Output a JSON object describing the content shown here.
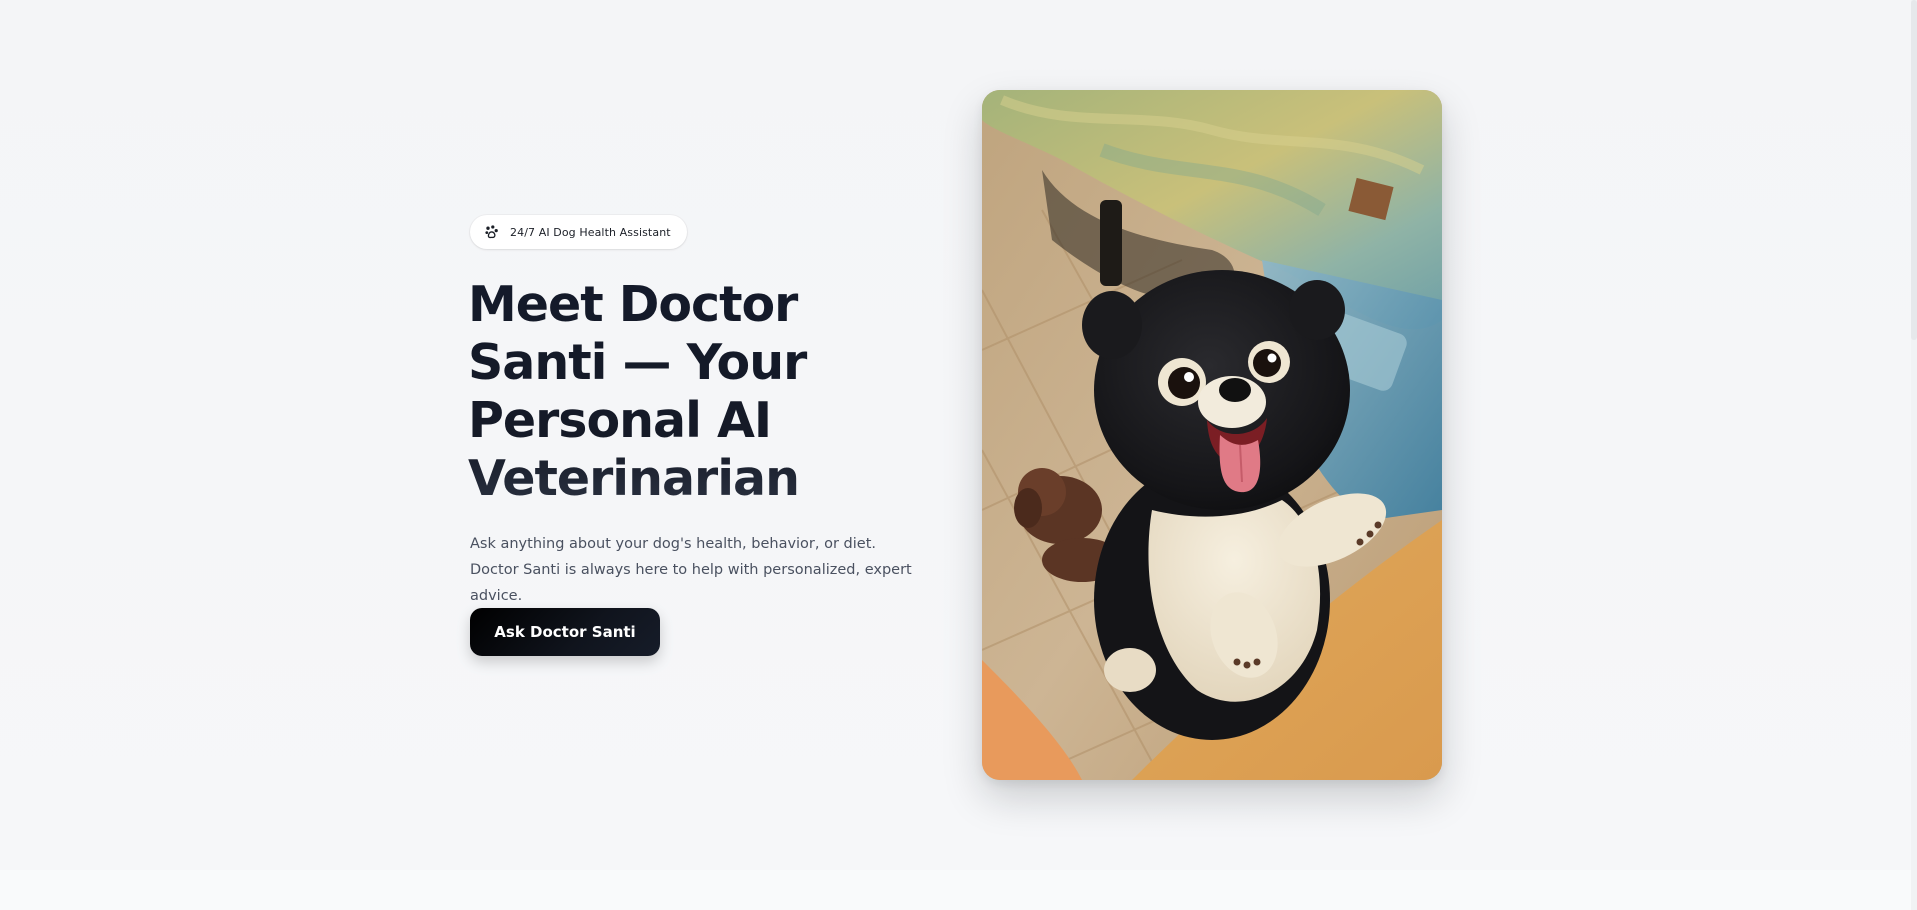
{
  "hero": {
    "badge": {
      "icon": "paw-icon",
      "text": "24/7 AI Dog Health Assistant"
    },
    "headline": "Meet Doctor Santi — Your Personal AI Veterinarian",
    "subtext": "Ask anything about your dog's health, behavior, or diet. Doctor Santi is always here to help with personalized, expert advice.",
    "cta_label": "Ask Doctor Santi"
  },
  "image": {
    "subject": "illustrated-puppy"
  },
  "colors": {
    "background": "#f5f6f8",
    "heading": "#161b28",
    "body_text": "#4a5160",
    "button_bg": "#0b0f17",
    "button_text": "#ffffff",
    "badge_bg": "#ffffff"
  }
}
